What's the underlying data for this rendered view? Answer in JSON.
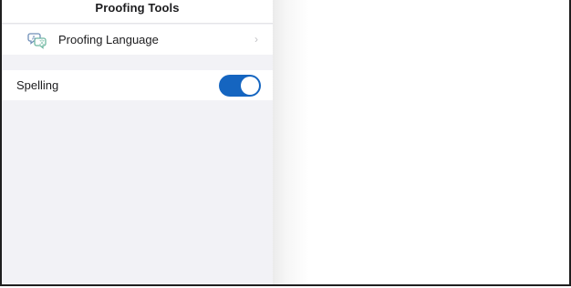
{
  "panel": {
    "title": "Proofing Tools",
    "items": [
      {
        "label": "Proofing Language",
        "icon": "language-icon",
        "chevron": "›"
      },
      {
        "label": "Spelling",
        "toggle": {
          "on": true,
          "color": "#1565c0"
        }
      }
    ]
  },
  "colors": {
    "panel_background": "#f2f2f6",
    "toggle_on": "#1565c0"
  }
}
